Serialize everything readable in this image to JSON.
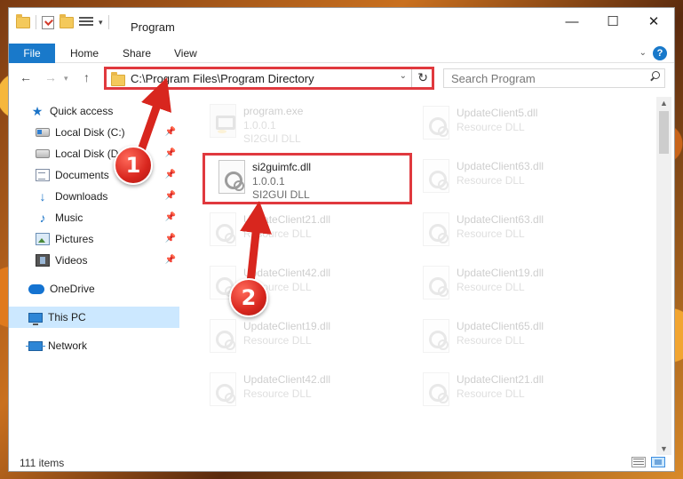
{
  "window": {
    "title": "Program",
    "controls": {
      "minimize": "—",
      "maximize": "☐",
      "close": "✕"
    }
  },
  "ribbon": {
    "tabs": [
      {
        "label": "File",
        "active": true
      },
      {
        "label": "Home"
      },
      {
        "label": "Share"
      },
      {
        "label": "View"
      }
    ],
    "help": "?"
  },
  "navigation": {
    "address": "C:\\Program Files\\Program Directory",
    "search_placeholder": "Search Program"
  },
  "sidebar": {
    "items": [
      {
        "label": "Quick access",
        "icon": "star-icon"
      },
      {
        "label": "Local Disk (C:)",
        "icon": "drive-icon",
        "pinned": true
      },
      {
        "label": "Local Disk (D:)",
        "icon": "drive-icon",
        "pinned": true
      },
      {
        "label": "Documents",
        "icon": "documents-icon",
        "pinned": true
      },
      {
        "label": "Downloads",
        "icon": "download-icon",
        "pinned": true
      },
      {
        "label": "Music",
        "icon": "music-icon",
        "pinned": true
      },
      {
        "label": "Pictures",
        "icon": "pictures-icon",
        "pinned": true
      },
      {
        "label": "Videos",
        "icon": "videos-icon",
        "pinned": true
      },
      {
        "label": "OneDrive",
        "icon": "cloud-icon"
      },
      {
        "label": "This PC",
        "icon": "computer-icon",
        "selected": true
      },
      {
        "label": "Network",
        "icon": "network-icon"
      }
    ]
  },
  "files": {
    "left": [
      {
        "name": "program.exe",
        "version": "1.0.0.1",
        "description": "SI2GUI DLL",
        "icon": "exe-icon",
        "faded": true
      },
      {
        "name": "si2guimfc.dll",
        "version": "1.0.0.1",
        "description": "SI2GUI DLL",
        "icon": "dll-icon",
        "highlight": true
      },
      {
        "name": "UpdateClient21.dll",
        "version": "",
        "description": "Resource DLL",
        "icon": "dll-icon",
        "faded": true
      },
      {
        "name": "UpdateClient42.dll",
        "version": "",
        "description": "Resource DLL",
        "icon": "dll-icon",
        "faded": true
      },
      {
        "name": "UpdateClient19.dll",
        "version": "",
        "description": "Resource DLL",
        "icon": "dll-icon",
        "faded": true
      },
      {
        "name": "UpdateClient42.dll",
        "version": "",
        "description": "Resource DLL",
        "icon": "dll-icon",
        "faded": true
      }
    ],
    "right": [
      {
        "name": "UpdateClient5.dll",
        "version": "",
        "description": "Resource DLL",
        "icon": "dll-icon",
        "faded": true
      },
      {
        "name": "UpdateClient63.dll",
        "version": "",
        "description": "Resource DLL",
        "icon": "dll-icon",
        "faded": true
      },
      {
        "name": "UpdateClient63.dll",
        "version": "",
        "description": "Resource DLL",
        "icon": "dll-icon",
        "faded": true
      },
      {
        "name": "UpdateClient19.dll",
        "version": "",
        "description": "Resource DLL",
        "icon": "dll-icon",
        "faded": true
      },
      {
        "name": "UpdateClient65.dll",
        "version": "",
        "description": "Resource DLL",
        "icon": "dll-icon",
        "faded": true
      },
      {
        "name": "UpdateClient21.dll",
        "version": "",
        "description": "Resource DLL",
        "icon": "dll-icon",
        "faded": true
      }
    ]
  },
  "status": {
    "item_count": "111 items"
  },
  "annotations": {
    "step1": "1",
    "step2": "2",
    "color": "#d8261e"
  },
  "colors": {
    "accent": "#1979ca",
    "highlight_border": "#e0393e",
    "selected_bg": "#cce8ff"
  }
}
